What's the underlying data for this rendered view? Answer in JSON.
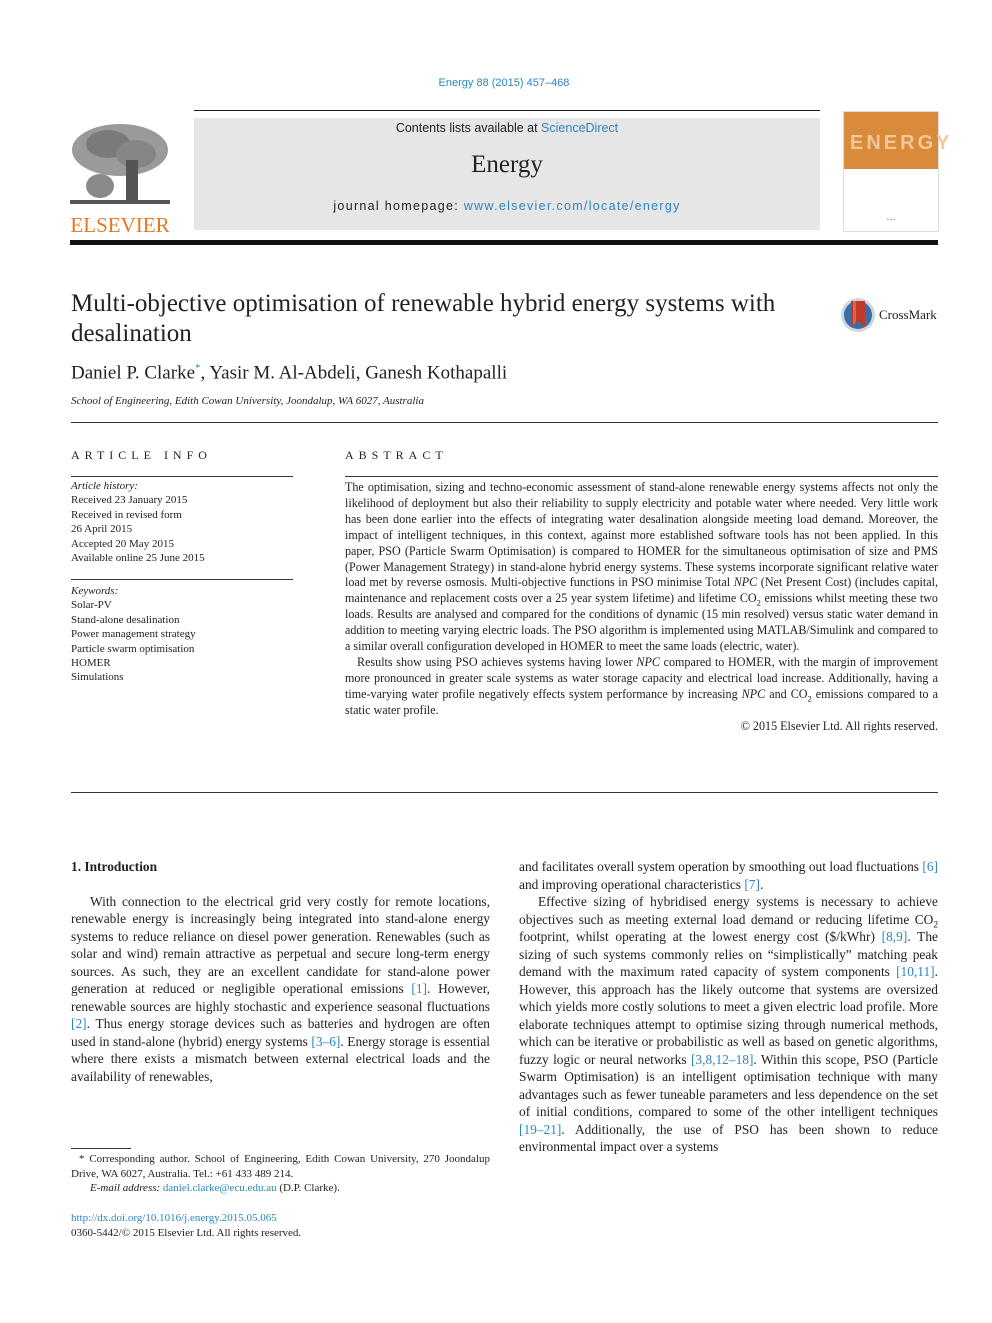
{
  "header": {
    "citation": "Energy 88 (2015) 457–468",
    "contents_prefix": "Contents lists available at ",
    "contents_link": "ScienceDirect",
    "journal_name": "Energy",
    "homepage_prefix": "journal homepage: ",
    "homepage_link": "www.elsevier.com/locate/energy",
    "publisher_logo_text": "ELSEVIER",
    "cover_title": "ENERGY",
    "brand_color": "#e87722",
    "link_color": "#2e86c1"
  },
  "article": {
    "title": "Multi-objective optimisation of renewable hybrid energy systems with desalination",
    "crossmark_label": "CrossMark",
    "authors": [
      {
        "name": "Daniel P. Clarke",
        "mark": "*"
      },
      {
        "name": "Yasir M. Al-Abdeli"
      },
      {
        "name": "Ganesh Kothapalli"
      }
    ],
    "author_sep": ", ",
    "affiliation": "School of Engineering, Edith Cowan University, Joondalup, WA 6027, Australia"
  },
  "article_info": {
    "heading": "ARTICLE INFO",
    "history_label": "Article history:",
    "history": [
      "Received 23 January 2015",
      "Received in revised form",
      "26 April 2015",
      "Accepted 20 May 2015",
      "Available online 25 June 2015"
    ],
    "keywords_label": "Keywords:",
    "keywords": [
      "Solar-PV",
      "Stand-alone desalination",
      "Power management strategy",
      "Particle swarm optimisation",
      "HOMER",
      "Simulations"
    ]
  },
  "abstract": {
    "heading": "ABSTRACT",
    "p1a": "The optimisation, sizing and techno-economic assessment of stand-alone renewable energy systems affects not only the likelihood of deployment but also their reliability to supply electricity and potable water where needed. Very little work has been done earlier into the effects of integrating water desalination alongside meeting load demand. Moreover, the impact of intelligent techniques, in this context, against more established software tools has not been applied. In this paper, PSO (Particle Swarm Optimisation) is compared to HOMER for the simultaneous optimisation of size and PMS (Power Management Strategy) in stand-alone hybrid energy systems. These systems incorporate significant relative water load met by reverse osmosis. Multi-objective functions in PSO minimise Total ",
    "npc": "NPC",
    "p1b": " (Net Present Cost) (includes capital, maintenance and replacement costs over a 25 year system lifetime) and lifetime CO",
    "sub2": "2",
    "p1c": " emissions whilst meeting these two loads. Results are analysed and compared for the conditions of dynamic (15 min resolved) versus static water demand in addition to meeting varying electric loads. The PSO algorithm is implemented using MATLAB/Simulink and compared to a similar overall configuration developed in HOMER to meet the same loads (electric, water).",
    "p2a": "Results show using PSO achieves systems having lower ",
    "p2b": " compared to HOMER, with the margin of improvement more pronounced in greater scale systems as water storage capacity and electrical load increase. Additionally, having a time-varying water profile negatively effects system performance by increasing ",
    "p2c": " and CO",
    "p2d": " emissions compared to a static water profile.",
    "copyright": "© 2015 Elsevier Ltd. All rights reserved."
  },
  "body": {
    "section_title": "1.  Introduction",
    "left_p1a": "With connection to the electrical grid very costly for remote locations, renewable energy is increasingly being integrated into stand-alone energy systems to reduce reliance on diesel power generation. Renewables (such as solar and wind) remain attractive as perpetual and secure long-term energy sources. As such, they are an excellent candidate for stand-alone power generation at reduced or negligible operational emissions ",
    "ref1": "[1]",
    "left_p1b": ". However, renewable sources are highly stochastic and experience seasonal fluctuations ",
    "ref2": "[2]",
    "left_p1c": ". Thus energy storage devices such as batteries and hydrogen are often used in stand-alone (hybrid) energy systems ",
    "ref3": "[3–6]",
    "left_p1d": ". Energy storage is essential where there exists a mismatch between external electrical loads and the availability of renewables,",
    "right_p1a": "and facilitates overall system operation by smoothing out load fluctuations ",
    "ref6": "[6]",
    "right_p1b": " and improving operational characteristics ",
    "ref7": "[7]",
    "right_p1c": ".",
    "right_p2a": "Effective sizing of hybridised energy systems is necessary to achieve objectives such as meeting external load demand or reducing lifetime CO",
    "right_p2b": " footprint, whilst operating at the lowest energy cost ($/kWhr) ",
    "ref8": "[8,9]",
    "right_p2c": ". The sizing of such systems commonly relies on “simplistically” matching peak demand with the maximum rated capacity of system components ",
    "ref10": "[10,11]",
    "right_p2d": ". However, this approach has the likely outcome that systems are oversized which yields more costly solutions to meet a given electric load profile. More elaborate techniques attempt to optimise sizing through numerical methods, which can be iterative or probabilistic as well as based on genetic algorithms, fuzzy logic or neural networks ",
    "ref12": "[3,8,12–18]",
    "right_p2e": ". Within this scope, PSO (Particle Swarm Optimisation) is an intelligent optimisation technique with many advantages such as fewer tuneable parameters and less dependence on the set of initial conditions, compared to some of the other intelligent techniques ",
    "ref19": "[19–21]",
    "right_p2f": ". Additionally, the use of PSO has been shown to reduce environmental impact over a systems"
  },
  "footnote": {
    "text": "* Corresponding author. School of Engineering, Edith Cowan University, 270 Joondalup Drive, WA 6027, Australia. Tel.: +61 433 489 214.",
    "email_label": "E-mail address: ",
    "email": "daniel.clarke@ecu.edu.au",
    "email_suffix": " (D.P. Clarke).",
    "doi": "http://dx.doi.org/10.1016/j.energy.2015.05.065",
    "issn": "0360-5442/© 2015 Elsevier Ltd. All rights reserved."
  }
}
